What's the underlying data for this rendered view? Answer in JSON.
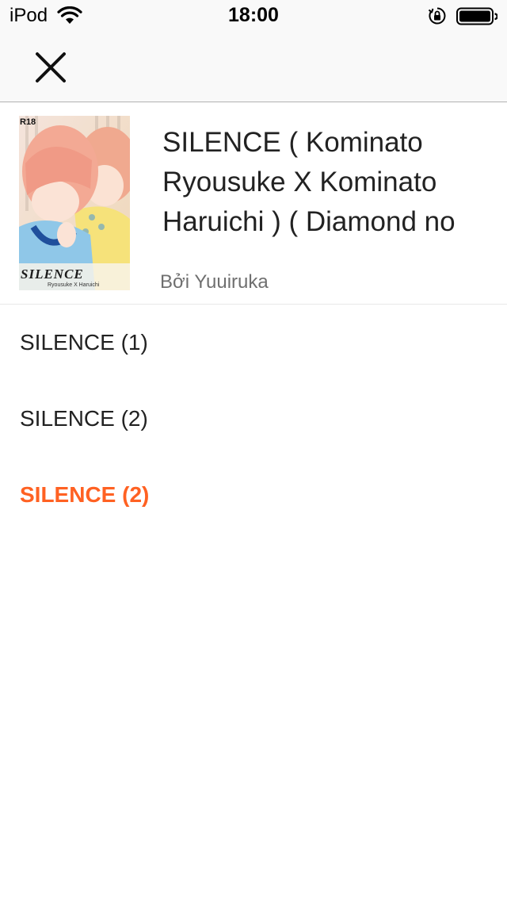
{
  "status_bar": {
    "device": "iPod",
    "time": "18:00",
    "icons": [
      "wifi-icon",
      "orientation-lock-icon",
      "battery-icon"
    ]
  },
  "nav": {
    "close_icon": "close-icon"
  },
  "story": {
    "title": "SILENCE ( Kominato Ryousuke X Kominato Haruichi ) ( Diamond no",
    "author": "Bởi Yuuiruka",
    "cover": {
      "badge": "R18",
      "title": "SILENCE",
      "subtitle": "Ryousuke X Haruichi"
    }
  },
  "chapters": [
    {
      "label": "SILENCE (1)",
      "active": false
    },
    {
      "label": "SILENCE (2)",
      "active": false
    },
    {
      "label": "SILENCE (2)",
      "active": true
    }
  ],
  "colors": {
    "accent": "#ff6122",
    "text": "#222222",
    "muted": "#6f6f6f",
    "divider": "#b2b2b2"
  }
}
